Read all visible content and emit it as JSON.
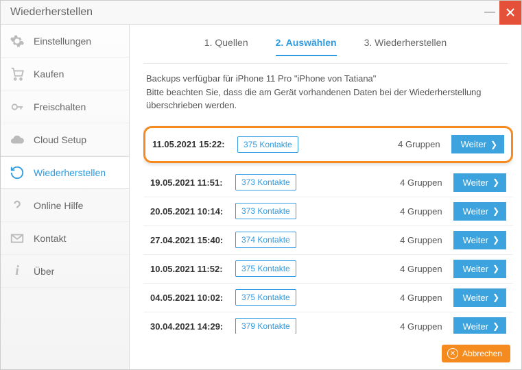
{
  "window": {
    "title": "Wiederherstellen"
  },
  "sidebar": {
    "items": [
      {
        "label": "Einstellungen"
      },
      {
        "label": "Kaufen"
      },
      {
        "label": "Freischalten"
      },
      {
        "label": "Cloud Setup"
      },
      {
        "label": "Wiederherstellen"
      },
      {
        "label": "Online Hilfe"
      },
      {
        "label": "Kontakt"
      },
      {
        "label": "Über"
      }
    ],
    "active_index": 4
  },
  "tabs": {
    "items": [
      {
        "label": "1. Quellen"
      },
      {
        "label": "2. Auswählen"
      },
      {
        "label": "3. Wiederherstellen"
      }
    ],
    "active_index": 1
  },
  "intro": {
    "line1": "Backups verfügbar für iPhone 11 Pro \"iPhone von Tatiana\"",
    "line2": "Bitte beachten Sie, dass die am Gerät vorhandenen Daten bei der Wiederherstellung überschrieben werden."
  },
  "backups": [
    {
      "date": "11.05.2021 15:22:",
      "contacts": "375 Kontakte",
      "groups": "4 Gruppen",
      "button": "Weiter",
      "highlight": true
    },
    {
      "date": "19.05.2021 11:51:",
      "contacts": "373 Kontakte",
      "groups": "4 Gruppen",
      "button": "Weiter",
      "highlight": false
    },
    {
      "date": "20.05.2021 10:14:",
      "contacts": "373 Kontakte",
      "groups": "4 Gruppen",
      "button": "Weiter",
      "highlight": false
    },
    {
      "date": "27.04.2021 15:40:",
      "contacts": "374 Kontakte",
      "groups": "4 Gruppen",
      "button": "Weiter",
      "highlight": false
    },
    {
      "date": "10.05.2021 11:52:",
      "contacts": "375 Kontakte",
      "groups": "4 Gruppen",
      "button": "Weiter",
      "highlight": false
    },
    {
      "date": "04.05.2021 10:02:",
      "contacts": "375 Kontakte",
      "groups": "4 Gruppen",
      "button": "Weiter",
      "highlight": false
    },
    {
      "date": "30.04.2021 14:29:",
      "contacts": "379 Kontakte",
      "groups": "4 Gruppen",
      "button": "Weiter",
      "highlight": false
    }
  ],
  "footer": {
    "cancel": "Abbrechen"
  }
}
